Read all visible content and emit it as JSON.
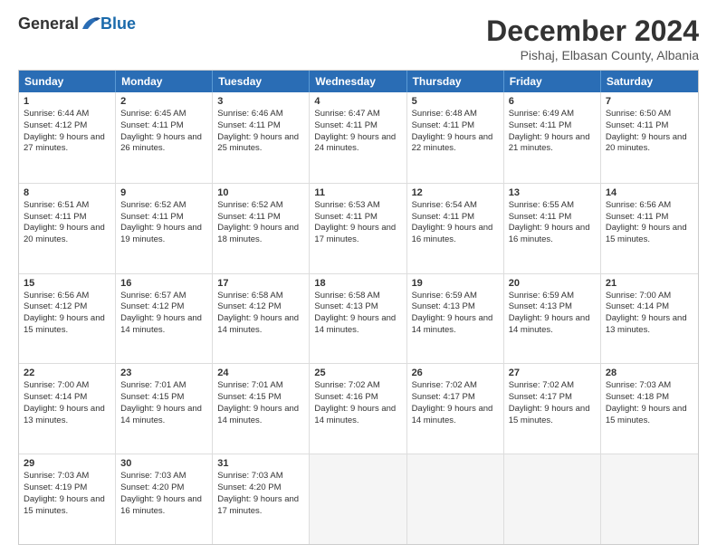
{
  "header": {
    "logo_general": "General",
    "logo_blue": "Blue",
    "month_title": "December 2024",
    "location": "Pishaj, Elbasan County, Albania"
  },
  "weekdays": [
    "Sunday",
    "Monday",
    "Tuesday",
    "Wednesday",
    "Thursday",
    "Friday",
    "Saturday"
  ],
  "rows": [
    [
      {
        "day": "1",
        "sunrise": "Sunrise: 6:44 AM",
        "sunset": "Sunset: 4:12 PM",
        "daylight": "Daylight: 9 hours and 27 minutes."
      },
      {
        "day": "2",
        "sunrise": "Sunrise: 6:45 AM",
        "sunset": "Sunset: 4:11 PM",
        "daylight": "Daylight: 9 hours and 26 minutes."
      },
      {
        "day": "3",
        "sunrise": "Sunrise: 6:46 AM",
        "sunset": "Sunset: 4:11 PM",
        "daylight": "Daylight: 9 hours and 25 minutes."
      },
      {
        "day": "4",
        "sunrise": "Sunrise: 6:47 AM",
        "sunset": "Sunset: 4:11 PM",
        "daylight": "Daylight: 9 hours and 24 minutes."
      },
      {
        "day": "5",
        "sunrise": "Sunrise: 6:48 AM",
        "sunset": "Sunset: 4:11 PM",
        "daylight": "Daylight: 9 hours and 22 minutes."
      },
      {
        "day": "6",
        "sunrise": "Sunrise: 6:49 AM",
        "sunset": "Sunset: 4:11 PM",
        "daylight": "Daylight: 9 hours and 21 minutes."
      },
      {
        "day": "7",
        "sunrise": "Sunrise: 6:50 AM",
        "sunset": "Sunset: 4:11 PM",
        "daylight": "Daylight: 9 hours and 20 minutes."
      }
    ],
    [
      {
        "day": "8",
        "sunrise": "Sunrise: 6:51 AM",
        "sunset": "Sunset: 4:11 PM",
        "daylight": "Daylight: 9 hours and 20 minutes."
      },
      {
        "day": "9",
        "sunrise": "Sunrise: 6:52 AM",
        "sunset": "Sunset: 4:11 PM",
        "daylight": "Daylight: 9 hours and 19 minutes."
      },
      {
        "day": "10",
        "sunrise": "Sunrise: 6:52 AM",
        "sunset": "Sunset: 4:11 PM",
        "daylight": "Daylight: 9 hours and 18 minutes."
      },
      {
        "day": "11",
        "sunrise": "Sunrise: 6:53 AM",
        "sunset": "Sunset: 4:11 PM",
        "daylight": "Daylight: 9 hours and 17 minutes."
      },
      {
        "day": "12",
        "sunrise": "Sunrise: 6:54 AM",
        "sunset": "Sunset: 4:11 PM",
        "daylight": "Daylight: 9 hours and 16 minutes."
      },
      {
        "day": "13",
        "sunrise": "Sunrise: 6:55 AM",
        "sunset": "Sunset: 4:11 PM",
        "daylight": "Daylight: 9 hours and 16 minutes."
      },
      {
        "day": "14",
        "sunrise": "Sunrise: 6:56 AM",
        "sunset": "Sunset: 4:11 PM",
        "daylight": "Daylight: 9 hours and 15 minutes."
      }
    ],
    [
      {
        "day": "15",
        "sunrise": "Sunrise: 6:56 AM",
        "sunset": "Sunset: 4:12 PM",
        "daylight": "Daylight: 9 hours and 15 minutes."
      },
      {
        "day": "16",
        "sunrise": "Sunrise: 6:57 AM",
        "sunset": "Sunset: 4:12 PM",
        "daylight": "Daylight: 9 hours and 14 minutes."
      },
      {
        "day": "17",
        "sunrise": "Sunrise: 6:58 AM",
        "sunset": "Sunset: 4:12 PM",
        "daylight": "Daylight: 9 hours and 14 minutes."
      },
      {
        "day": "18",
        "sunrise": "Sunrise: 6:58 AM",
        "sunset": "Sunset: 4:13 PM",
        "daylight": "Daylight: 9 hours and 14 minutes."
      },
      {
        "day": "19",
        "sunrise": "Sunrise: 6:59 AM",
        "sunset": "Sunset: 4:13 PM",
        "daylight": "Daylight: 9 hours and 14 minutes."
      },
      {
        "day": "20",
        "sunrise": "Sunrise: 6:59 AM",
        "sunset": "Sunset: 4:13 PM",
        "daylight": "Daylight: 9 hours and 14 minutes."
      },
      {
        "day": "21",
        "sunrise": "Sunrise: 7:00 AM",
        "sunset": "Sunset: 4:14 PM",
        "daylight": "Daylight: 9 hours and 13 minutes."
      }
    ],
    [
      {
        "day": "22",
        "sunrise": "Sunrise: 7:00 AM",
        "sunset": "Sunset: 4:14 PM",
        "daylight": "Daylight: 9 hours and 13 minutes."
      },
      {
        "day": "23",
        "sunrise": "Sunrise: 7:01 AM",
        "sunset": "Sunset: 4:15 PM",
        "daylight": "Daylight: 9 hours and 14 minutes."
      },
      {
        "day": "24",
        "sunrise": "Sunrise: 7:01 AM",
        "sunset": "Sunset: 4:15 PM",
        "daylight": "Daylight: 9 hours and 14 minutes."
      },
      {
        "day": "25",
        "sunrise": "Sunrise: 7:02 AM",
        "sunset": "Sunset: 4:16 PM",
        "daylight": "Daylight: 9 hours and 14 minutes."
      },
      {
        "day": "26",
        "sunrise": "Sunrise: 7:02 AM",
        "sunset": "Sunset: 4:17 PM",
        "daylight": "Daylight: 9 hours and 14 minutes."
      },
      {
        "day": "27",
        "sunrise": "Sunrise: 7:02 AM",
        "sunset": "Sunset: 4:17 PM",
        "daylight": "Daylight: 9 hours and 15 minutes."
      },
      {
        "day": "28",
        "sunrise": "Sunrise: 7:03 AM",
        "sunset": "Sunset: 4:18 PM",
        "daylight": "Daylight: 9 hours and 15 minutes."
      }
    ],
    [
      {
        "day": "29",
        "sunrise": "Sunrise: 7:03 AM",
        "sunset": "Sunset: 4:19 PM",
        "daylight": "Daylight: 9 hours and 15 minutes."
      },
      {
        "day": "30",
        "sunrise": "Sunrise: 7:03 AM",
        "sunset": "Sunset: 4:20 PM",
        "daylight": "Daylight: 9 hours and 16 minutes."
      },
      {
        "day": "31",
        "sunrise": "Sunrise: 7:03 AM",
        "sunset": "Sunset: 4:20 PM",
        "daylight": "Daylight: 9 hours and 17 minutes."
      },
      null,
      null,
      null,
      null
    ]
  ]
}
